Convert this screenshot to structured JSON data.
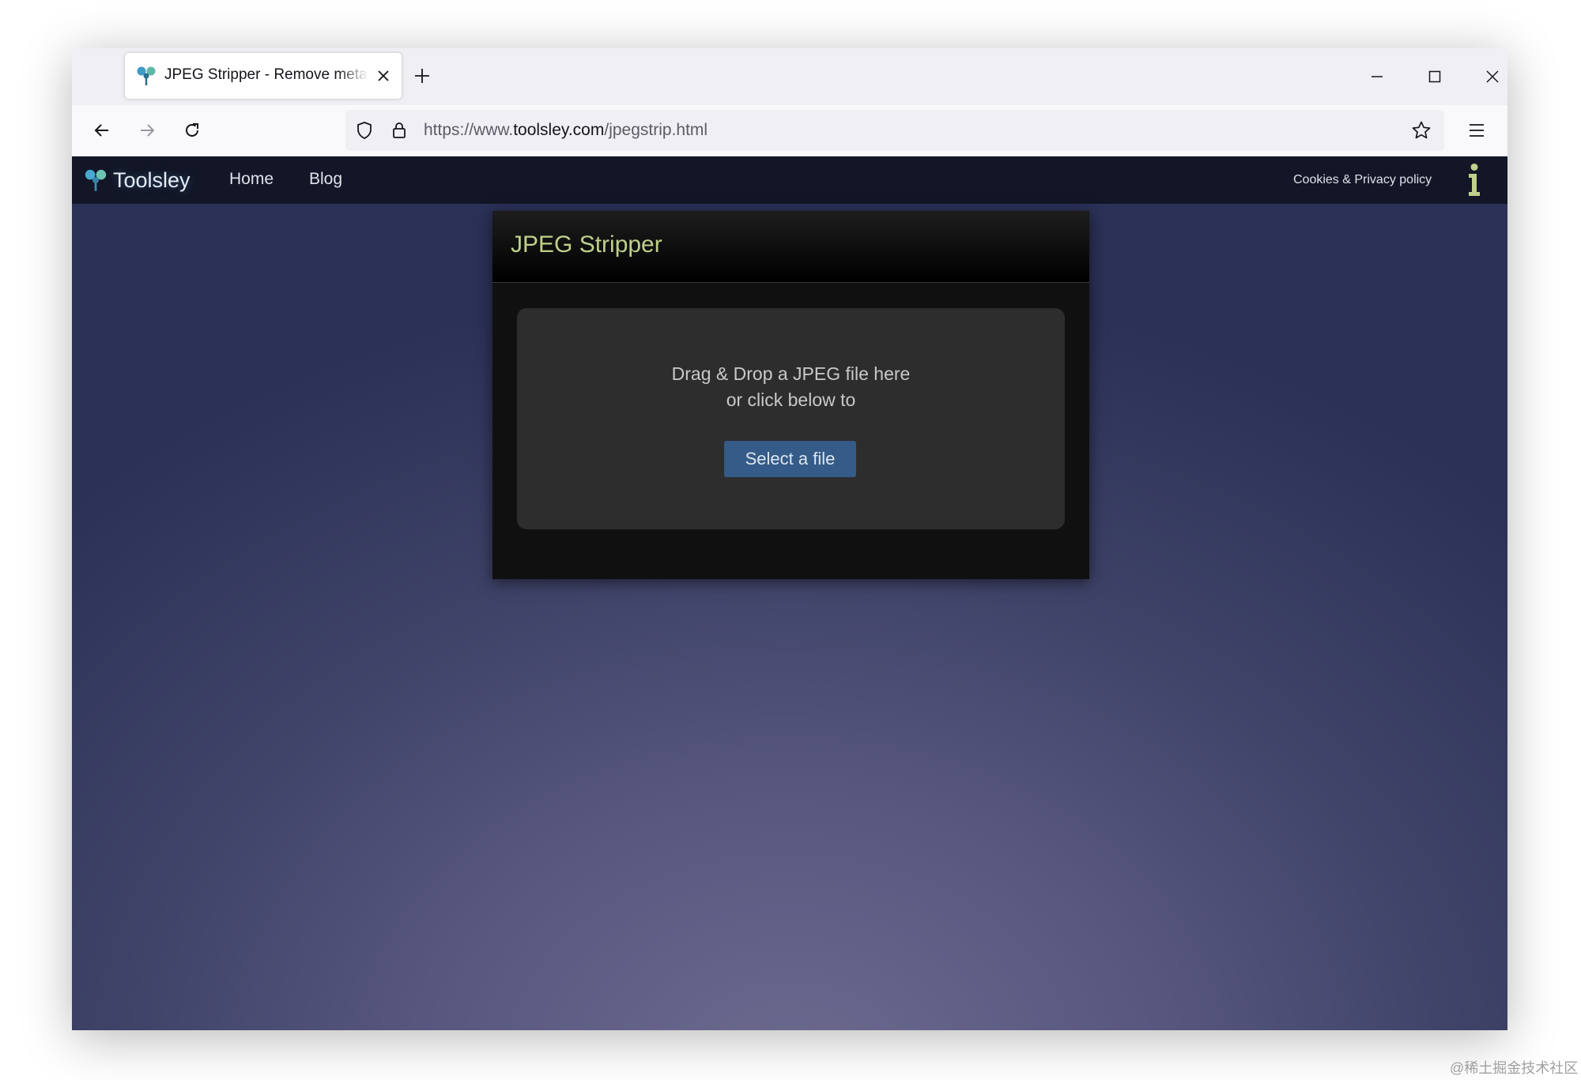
{
  "browser": {
    "tab_title": "JPEG Stripper - Remove metadata",
    "url_prefix": "https://www.",
    "url_domain": "toolsley.com",
    "url_path": "/jpegstrip.html"
  },
  "site": {
    "brand": "Toolsley",
    "nav": {
      "home": "Home",
      "blog": "Blog"
    },
    "cookies_link": "Cookies & Privacy policy"
  },
  "card": {
    "title": "JPEG Stripper",
    "drop_line1": "Drag & Drop a JPEG file here",
    "drop_line2": "or click below to",
    "button_label": "Select a file"
  },
  "watermark": "@稀土掘金技术社区",
  "colors": {
    "accent_title": "#bed08a",
    "button": "#355b88",
    "site_bar": "#121626"
  },
  "icons": [
    "toolsley-logo-icon",
    "close-icon",
    "plus-icon",
    "minimize-icon",
    "maximize-icon",
    "back-arrow-icon",
    "forward-arrow-icon",
    "reload-icon",
    "shield-icon",
    "lock-icon",
    "star-icon",
    "hamburger-menu-icon",
    "info-icon"
  ]
}
